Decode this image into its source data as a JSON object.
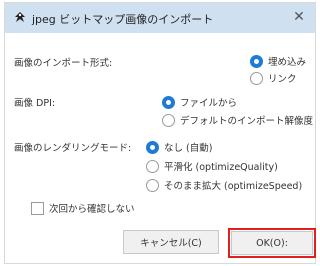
{
  "window": {
    "title": "jpeg ビットマップ画像のインポート",
    "close_glyph": "✕"
  },
  "import_type": {
    "label": "画像のインポート形式:",
    "options": [
      {
        "label": "埋め込み",
        "selected": true
      },
      {
        "label": "リンク",
        "selected": false
      }
    ]
  },
  "dpi": {
    "label": "画像 DPI:",
    "options": [
      {
        "label": "ファイルから",
        "selected": true
      },
      {
        "label": "デフォルトのインポート解像度",
        "selected": false
      }
    ]
  },
  "rendering": {
    "label": "画像のレンダリングモード:",
    "options": [
      {
        "label": "なし (自動)",
        "selected": true
      },
      {
        "label": "平滑化 (optimizeQuality)",
        "selected": false
      },
      {
        "label": "そのまま拡大 (optimizeSpeed)",
        "selected": false
      }
    ]
  },
  "dont_ask": {
    "label": "次回から確認しない",
    "checked": false
  },
  "buttons": {
    "cancel": "キャンセル(C)",
    "ok": "OK(O):"
  },
  "colors": {
    "accent": "#1e7ad6",
    "titlebar": "#cfe0f0",
    "highlight": "#e02020"
  }
}
